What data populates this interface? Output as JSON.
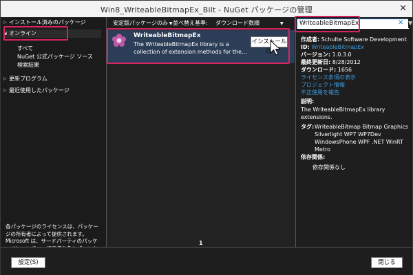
{
  "window": {
    "title": "Win8_WriteableBitmapEx_Bilt - NuGet パッケージの管理",
    "close_glyph": "✕"
  },
  "sidebar": {
    "items": [
      {
        "label": "インストール済みのパッケージ",
        "arrow": "▷"
      },
      {
        "label": "オンライン",
        "arrow": "◢"
      },
      {
        "label": "更新プログラム",
        "arrow": "▷"
      },
      {
        "label": "最近使用したパッケージ",
        "arrow": "▷"
      }
    ],
    "online_sub": [
      "すべて",
      "NuGet 公式パッケージ ソース",
      "検索結果"
    ],
    "license_note": "各パッケージのライセンスは、パッケージの所有者によって提供されます。Microsoft は、サードパーティのパッケージについて、一切責任を負わず、いかなるライセンスも提供しません。"
  },
  "filter": {
    "stable": "安定版パッケージのみ",
    "sort_label": "並べ替え基準:",
    "sort_value": "ダウンロード数順",
    "arrow": "▼"
  },
  "search": {
    "value": "WriteableBitmapEx",
    "clear_glyph": "✕",
    "scroll_glyph": "▼"
  },
  "package": {
    "name": "WriteableBitmapEx",
    "desc_line1": "The WriteableBitmapEx library is a",
    "desc_line2": "collection of extension methods for the…",
    "install_label": "インストール(I)"
  },
  "pager": {
    "page": "1"
  },
  "details": {
    "author_k": "作成者:",
    "author_v": "Schulte Software Development",
    "id_k": "ID:",
    "id_v": "WriteableBitmapEx",
    "version_k": "バージョン:",
    "version_v": "1.0.3.0",
    "updated_k": "最終更新日:",
    "updated_v": "8/28/2012",
    "downloads_k": "ダウンロード:",
    "downloads_v": "1656",
    "link_license": "ライセンス条項の表示",
    "link_project": "プロジェクト情報",
    "link_report": "不正使用を報告",
    "desc_k": "説明:",
    "desc_v1": "The WriteableBitmapEx library",
    "desc_v2": "extensions.",
    "tags_k": "タグ:",
    "tags_v": "WriteableBitmap Bitmap Graphics Silverlight WP7 WP7Dev WindowsPhone WPF .NET WinRT Metro",
    "deps_k": "依存関係:",
    "deps_v": "依存関係なし"
  },
  "footer": {
    "settings_label": "設定(S)",
    "close_label": "閉じる"
  },
  "colors": {
    "highlight": "#d7245f",
    "selected_row": "#2c3e57",
    "link": "#3c9be0",
    "search_border": "#1f78c8"
  }
}
